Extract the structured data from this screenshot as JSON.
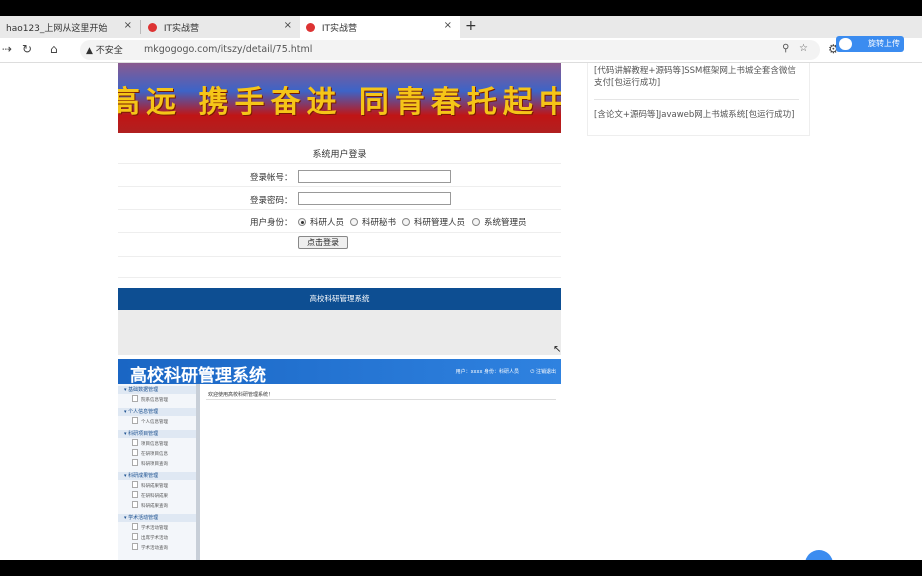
{
  "browser": {
    "tabs": [
      {
        "title": "hao123_上网从这里开始",
        "close": "×"
      },
      {
        "title": "IT实战营",
        "close": "×"
      },
      {
        "title": "IT实战营",
        "close": "×"
      }
    ],
    "new_tab": "+",
    "insecure_label": "不安全",
    "url": "mkgogogo.com/itszy/detail/75.html",
    "upload_label": "旋转上传"
  },
  "right_panel": {
    "links": [
      "[代码讲解教程+源码等]SSM框架网上书城全套含微信支付[包运行成功]",
      "[含论文+源码等]Javaweb网上书城系统[包运行成功]"
    ]
  },
  "login": {
    "banner_text": "高远  携手奋进  同青春托起中",
    "title": "系统用户登录",
    "account_label": "登录帐号：",
    "password_label": "登录密码：",
    "role_label": "用户身份：",
    "roles": [
      "科研人员",
      "科研秘书",
      "科研管理人员",
      "系统管理员"
    ],
    "selected_role": 0,
    "submit": "点击登录",
    "footer": "高校科研管理系统"
  },
  "app_preview": {
    "title": "高校科研管理系统",
    "user_info": "用户：xxxx 身份：科研人员",
    "logout": "注销退出",
    "welcome": "欢迎使用高校科研管理系统！",
    "menu": [
      {
        "group": "基础数据管理",
        "items": [
          "院系信息管理"
        ]
      },
      {
        "group": "个人信息管理",
        "items": [
          "个人信息管理"
        ]
      },
      {
        "group": "科研项目管理",
        "items": [
          "项目信息管理",
          "在研项目信息",
          "科研项目查询"
        ]
      },
      {
        "group": "科研成果管理",
        "items": [
          "科研成果管理",
          "在研科研成果",
          "科研成果查询"
        ]
      },
      {
        "group": "学术活动管理",
        "items": [
          "学术活动管理",
          "出席学术活动",
          "学术活动查询"
        ]
      }
    ]
  }
}
